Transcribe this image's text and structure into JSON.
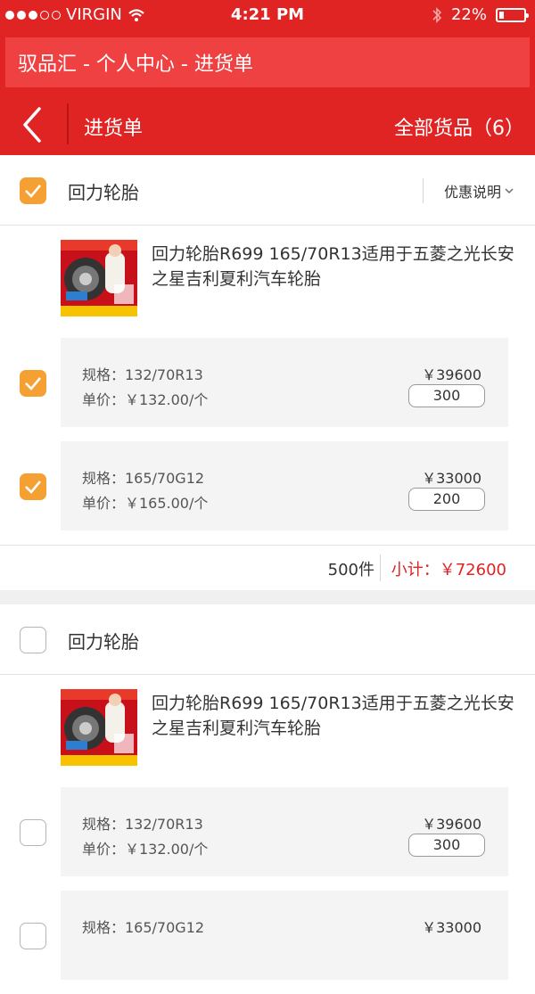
{
  "status_bar": {
    "carrier": "VIRGIN",
    "time": "4:21 PM",
    "battery": "22%",
    "battery_level": 0.22
  },
  "banner": {
    "title": "驭品汇 - 个人中心 - 进货单"
  },
  "navbar": {
    "title": "进货单",
    "right": "全部货品（6）"
  },
  "colors": {
    "primary_red": "#e02323",
    "checkbox_orange": "#f5a033"
  },
  "shops": [
    {
      "name": "回力轮胎",
      "checked": true,
      "promo": "优惠说明",
      "product_title": "回力轮胎R699 165/70R13适用于五菱之光长安之星吉利夏利汽车轮胎",
      "skus": [
        {
          "spec": "规格：132/70R13",
          "price": "单价：￥132.00/个",
          "total": "￥39600",
          "qty": "300",
          "checked": true
        },
        {
          "spec": "规格：165/70G12",
          "price": "单价：￥165.00/个",
          "total": "￥33000",
          "qty": "200",
          "checked": true
        }
      ],
      "count": "500件",
      "subtotal": "小计：￥72600"
    },
    {
      "name": "回力轮胎",
      "checked": false,
      "product_title": "回力轮胎R699 165/70R13适用于五菱之光长安之星吉利夏利汽车轮胎",
      "skus": [
        {
          "spec": "规格：132/70R13",
          "price": "单价：￥132.00/个",
          "total": "￥39600",
          "qty": "300",
          "checked": false
        },
        {
          "spec": "规格：165/70G12",
          "price": "",
          "total": "￥33000",
          "qty": "",
          "checked": false
        }
      ]
    }
  ]
}
